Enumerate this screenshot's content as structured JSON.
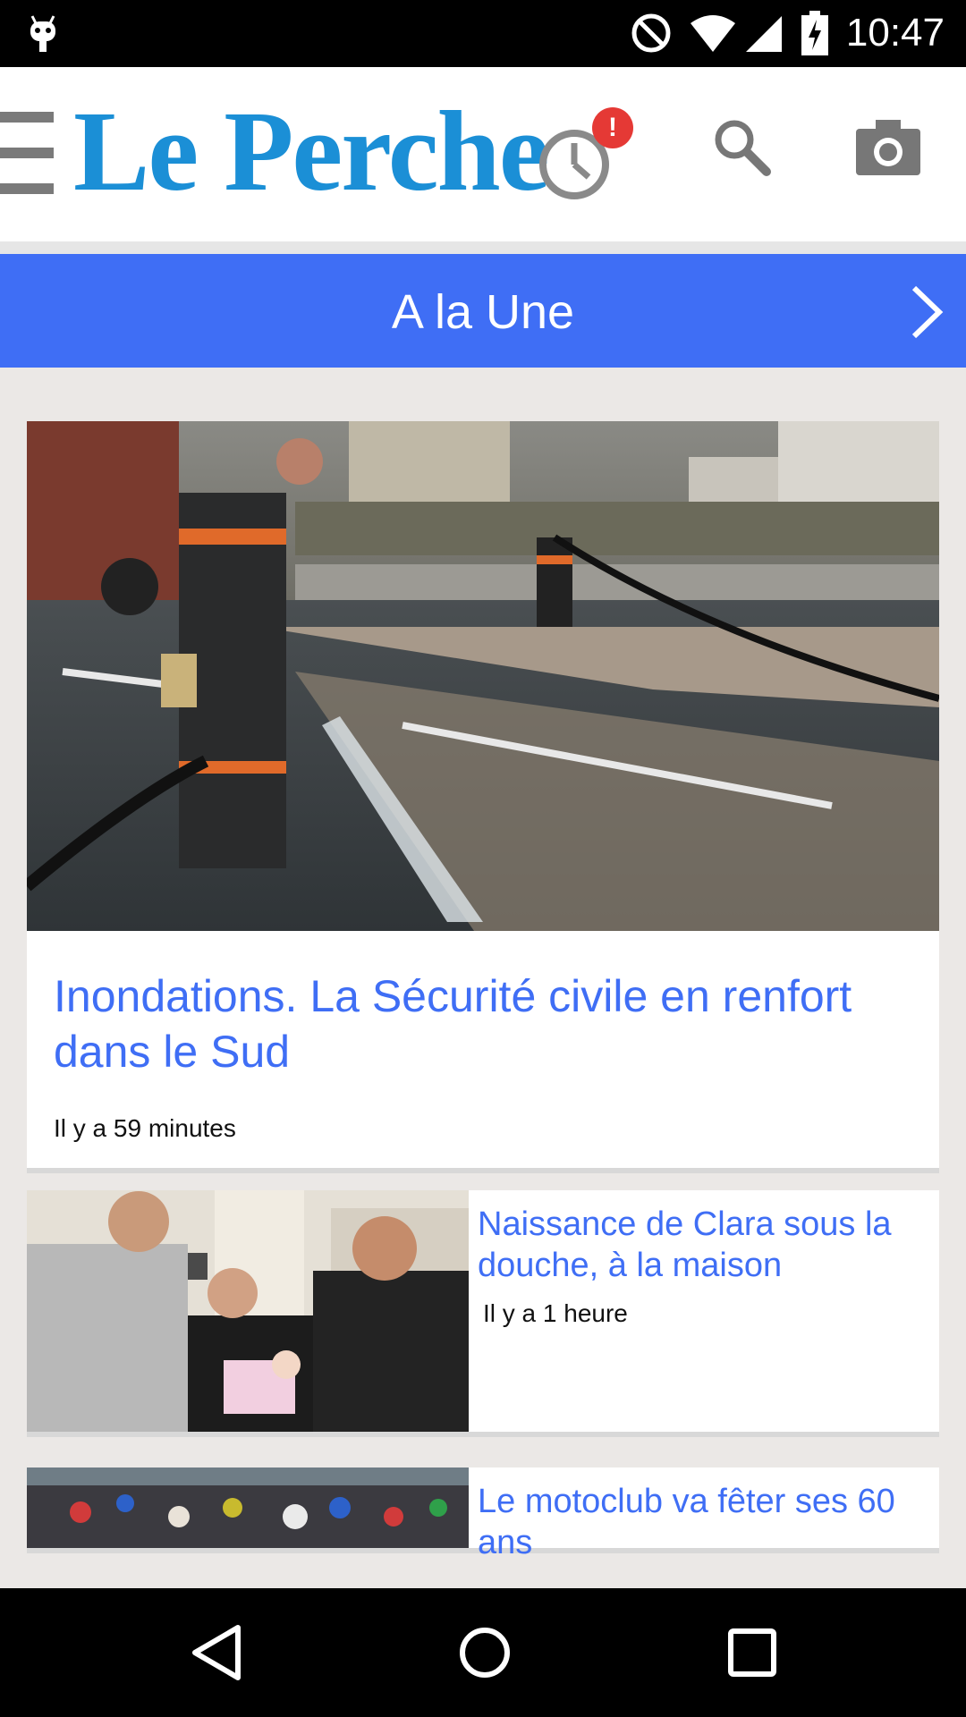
{
  "status_bar": {
    "time": "10:47"
  },
  "header": {
    "logo_text": "Le Perche",
    "history_badge": "!"
  },
  "section": {
    "title": "A la Une"
  },
  "articles": [
    {
      "headline": "Inondations. La Sécurité civile en renfort dans le Sud",
      "time": "Il y a 59 minutes"
    },
    {
      "headline": "Naissance de Clara sous la douche, à la maison",
      "time": "Il y a 1 heure"
    },
    {
      "headline": "Le motoclub va fêter ses 60 ans",
      "time": ""
    }
  ],
  "colors": {
    "accent": "#3f6ef5",
    "logo": "#1b8fd6",
    "badge": "#e53935"
  }
}
